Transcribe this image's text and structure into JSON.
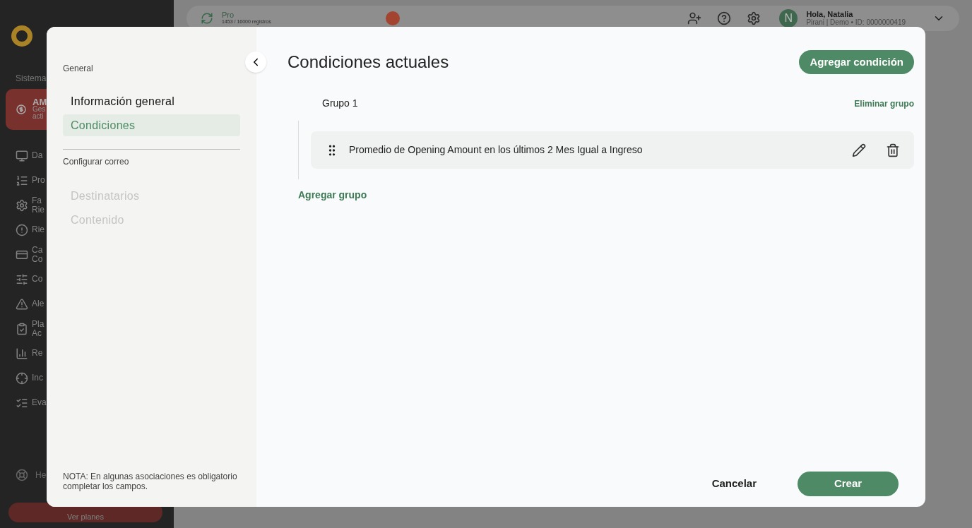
{
  "background": {
    "sidebar": {
      "section_label": "Sistema",
      "active_module": {
        "title": "AM",
        "subtitle_lines": [
          "Ges",
          "acti"
        ]
      },
      "items": [
        {
          "kind": "monitor",
          "lines": [
            "Da"
          ]
        },
        {
          "kind": "list",
          "lines": [
            "Pro"
          ]
        },
        {
          "kind": "gear",
          "lines": [
            "Fa",
            "Rie"
          ]
        },
        {
          "kind": "alert",
          "lines": [
            "Rie"
          ]
        },
        {
          "kind": "card",
          "lines": [
            "Ca",
            "Co"
          ]
        },
        {
          "kind": "sliders",
          "lines": [
            "Co"
          ]
        },
        {
          "kind": "warning",
          "lines": [
            "Ale"
          ]
        },
        {
          "kind": "clipboard",
          "lines": [
            "Pla",
            "Ac"
          ]
        },
        {
          "kind": "chart",
          "lines": [
            "Re"
          ]
        },
        {
          "kind": "target",
          "lines": [
            "Inc"
          ]
        },
        {
          "kind": "check",
          "lines": [
            "Eva"
          ]
        }
      ],
      "help": "He",
      "plans_button": "Ver planes"
    },
    "topbar": {
      "plan": "Pro",
      "records": "1453 / 16000 registros",
      "greeting": "Hola, Natalia",
      "avatar": "N",
      "account": "Pirani | Demo • ID: 0000000419"
    }
  },
  "dialog": {
    "nav": {
      "sections": [
        {
          "label": "General",
          "items": [
            {
              "label": "Información general",
              "selected": false,
              "disabled": false
            },
            {
              "label": "Condiciones",
              "selected": true,
              "disabled": false
            }
          ]
        },
        {
          "label": "Configurar correo",
          "items": [
            {
              "label": "Destinatarios",
              "selected": false,
              "disabled": true
            },
            {
              "label": "Contenido",
              "selected": false,
              "disabled": true
            }
          ]
        }
      ],
      "note": "NOTA: En algunas asociaciones es obligatorio completar los campos."
    },
    "title": "Condiciones actuales",
    "add_condition": "Agregar condición",
    "groups": [
      {
        "name": "Grupo 1",
        "delete": "Eliminar grupo",
        "conditions": [
          "Promedio de Opening Amount en los últimos 2 Mes Igual a Ingreso"
        ]
      }
    ],
    "add_group": "Agregar grupo",
    "cancel": "Cancelar",
    "create": "Crear"
  }
}
